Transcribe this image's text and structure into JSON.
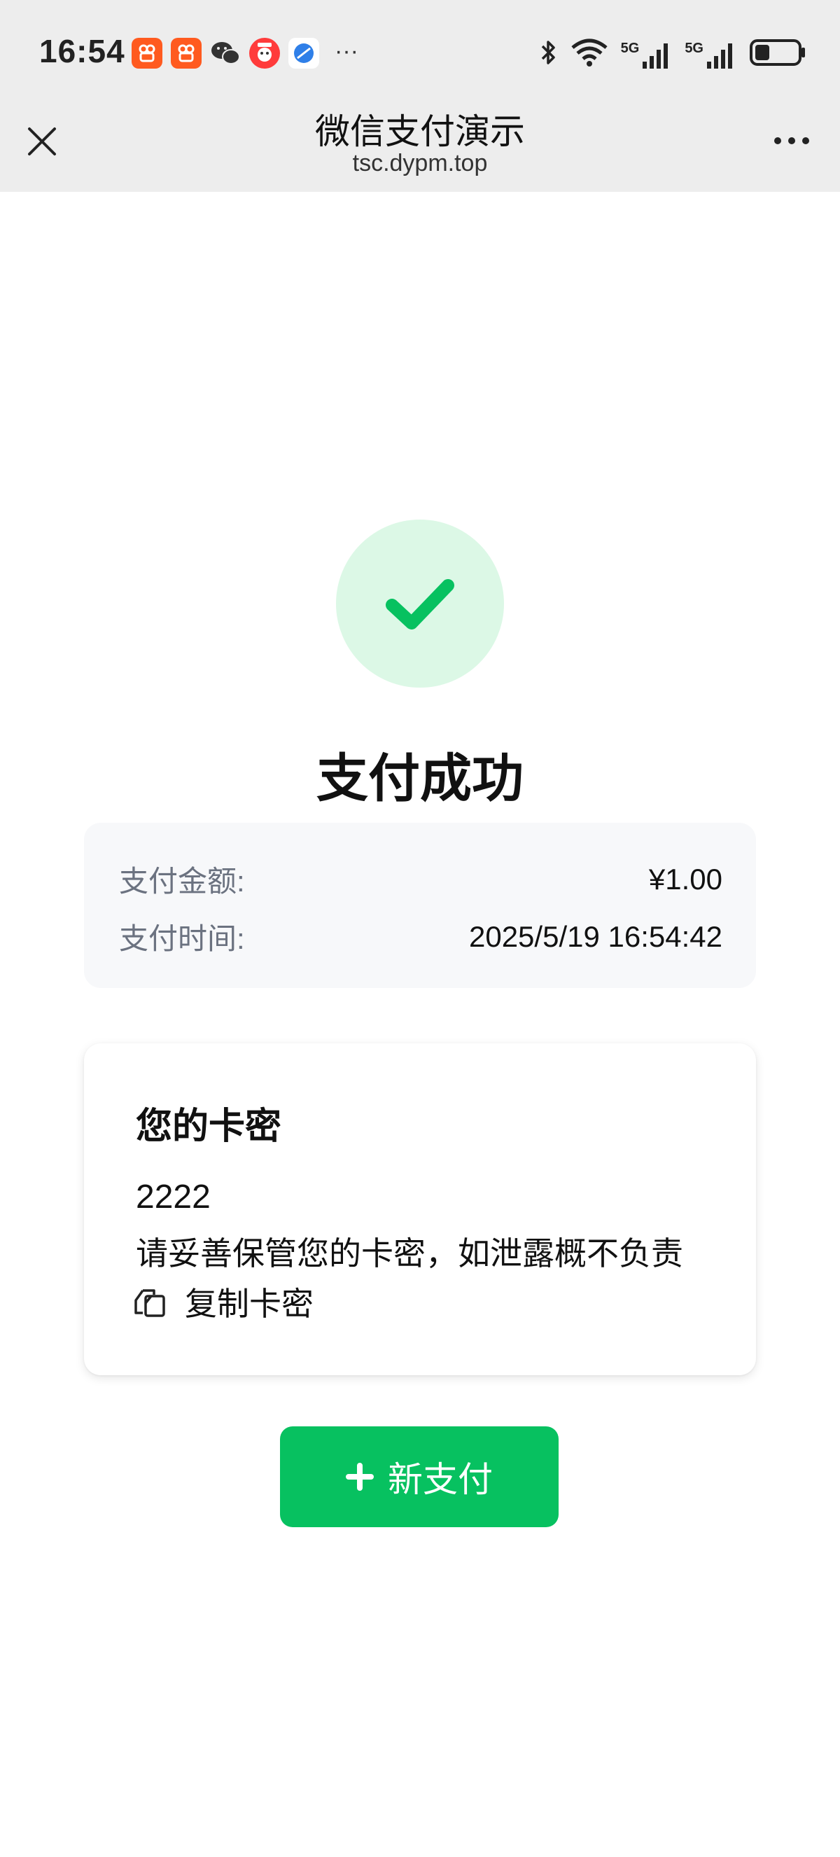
{
  "status_bar": {
    "time": "16:54",
    "more": "···",
    "network_1": "5G",
    "network_2": "5G"
  },
  "nav": {
    "title": "微信支付演示",
    "url": "tsc.dypm.top"
  },
  "result": {
    "title": "支付成功",
    "amount_label": "支付金额:",
    "amount_value": "¥1.00",
    "time_label": "支付时间:",
    "time_value": "2025/5/19 16:54:42"
  },
  "secret": {
    "title": "您的卡密",
    "code": "2222",
    "note": "请妥善保管您的卡密，如泄露概不负责",
    "copy_label": "复制卡密"
  },
  "actions": {
    "new_pay_label": "新支付"
  },
  "colors": {
    "accent": "#07c160",
    "success_bg": "#dcf8e6",
    "bar_bg": "#ededed",
    "card_bg": "#f7f8fa"
  }
}
